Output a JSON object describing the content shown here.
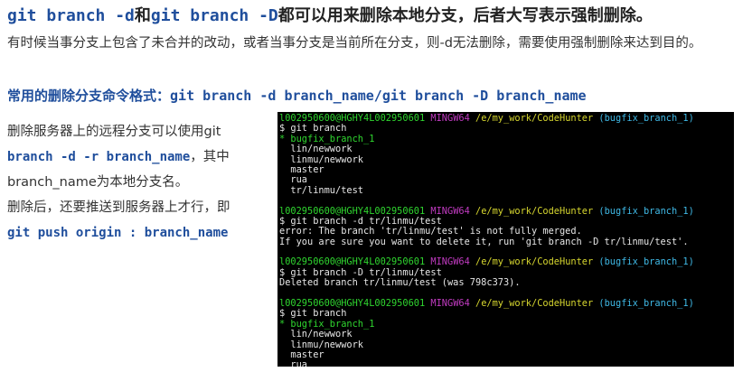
{
  "heading": {
    "cmd1": "git branch -d",
    "and": "和",
    "cmd2": "git branch -D",
    "rest": "都可以用来删除本地分支，后者大写表示强制删除。"
  },
  "paragraph": "有时候当事分支上包含了未合并的改动，或者当事分支是当前所在分支，则-d无法删除，需要使用强制删除来达到目的。",
  "subhead": {
    "label": "常用的删除分支命令格式：",
    "cmd": "git branch -d branch_name/git branch -D branch_name"
  },
  "left": {
    "line1": "删除服务器上的远程分支可以使用git",
    "cmd1": "branch -d -r branch_name",
    "line2a": "，其中",
    "line3": "branch_name为本地分支名。",
    "line4": "删除后，还要推送到服务器上才行，即",
    "cmd2": "git push origin : branch_name"
  },
  "terminal": {
    "prompt_user": "l002950600@HGHY4L002950601",
    "prompt_host": "MINGW64",
    "prompt_path": "/e/my_work/CodeHunter",
    "prompt_branch": "(bugfix_branch_1)",
    "blocks": [
      {
        "command": "$ git branch",
        "output": [
          {
            "text": "* bugfix_branch_1",
            "current": true
          },
          {
            "text": "  lin/newwork"
          },
          {
            "text": "  linmu/newwork"
          },
          {
            "text": "  master"
          },
          {
            "text": "  rua"
          },
          {
            "text": "  tr/linmu/test"
          }
        ]
      },
      {
        "command": "$ git branch -d tr/linmu/test",
        "output": [
          {
            "text": "error: The branch 'tr/linmu/test' is not fully merged."
          },
          {
            "text": "If you are sure you want to delete it, run 'git branch -D tr/linmu/test'."
          }
        ]
      },
      {
        "command": "$ git branch -D tr/linmu/test",
        "output": [
          {
            "text": "Deleted branch tr/linmu/test (was 798c373)."
          }
        ]
      },
      {
        "command": "$ git branch",
        "output": [
          {
            "text": "* bugfix_branch_1",
            "current": true
          },
          {
            "text": "  lin/newwork"
          },
          {
            "text": "  linmu/newwork"
          },
          {
            "text": "  master"
          },
          {
            "text": "  rua"
          }
        ]
      }
    ]
  }
}
